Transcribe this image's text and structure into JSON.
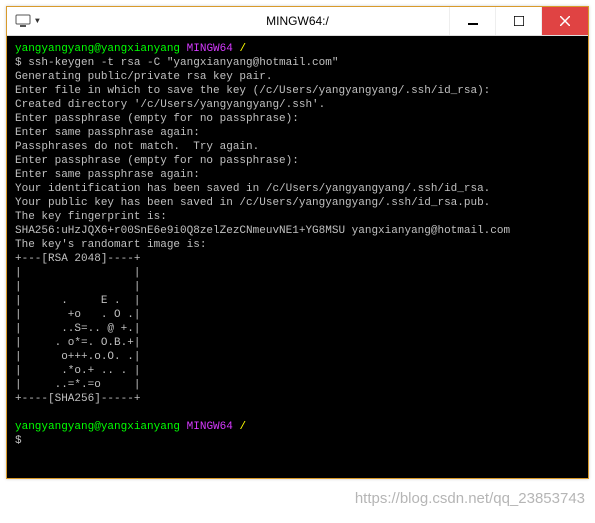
{
  "title": "MINGW64:/",
  "prompt": {
    "user": "yangyangyang@yangxianyang",
    "env": "MINGW64",
    "path": "/",
    "symbol": "$"
  },
  "command": " ssh-keygen -t rsa -C \"yangxianyang@hotmail.com\"",
  "out": {
    "l1": "Generating public/private rsa key pair.",
    "l2": "Enter file in which to save the key (/c/Users/yangyangyang/.ssh/id_rsa):",
    "l3": "Created directory '/c/Users/yangyangyang/.ssh'.",
    "l4": "Enter passphrase (empty for no passphrase):",
    "l5": "Enter same passphrase again:",
    "l6": "Passphrases do not match.  Try again.",
    "l7": "Enter passphrase (empty for no passphrase):",
    "l8": "Enter same passphrase again:",
    "l9": "Your identification has been saved in /c/Users/yangyangyang/.ssh/id_rsa.",
    "l10": "Your public key has been saved in /c/Users/yangyangyang/.ssh/id_rsa.pub.",
    "l11": "The key fingerprint is:",
    "l12": "SHA256:uHzJQX6+r00SnE6e9i0Q8zelZezCNmeuvNE1+YG8MSU yangxianyang@hotmail.com",
    "l13": "The key's randomart image is:"
  },
  "art": {
    "a1": "+---[RSA 2048]----+",
    "a2": "|                 |",
    "a3": "|                 |",
    "a4": "|      .     E .  |",
    "a5": "|       +o   . O .|",
    "a6": "|      ..S=.. @ +.|",
    "a7": "|     . o*=. O.B.+|",
    "a8": "|      o+++.o.O. .|",
    "a9": "|      .*o.+ .. . |",
    "a10": "|     ..=*.=o     |",
    "a11": "+----[SHA256]-----+"
  },
  "watermark": "https://blog.csdn.net/qq_23853743"
}
